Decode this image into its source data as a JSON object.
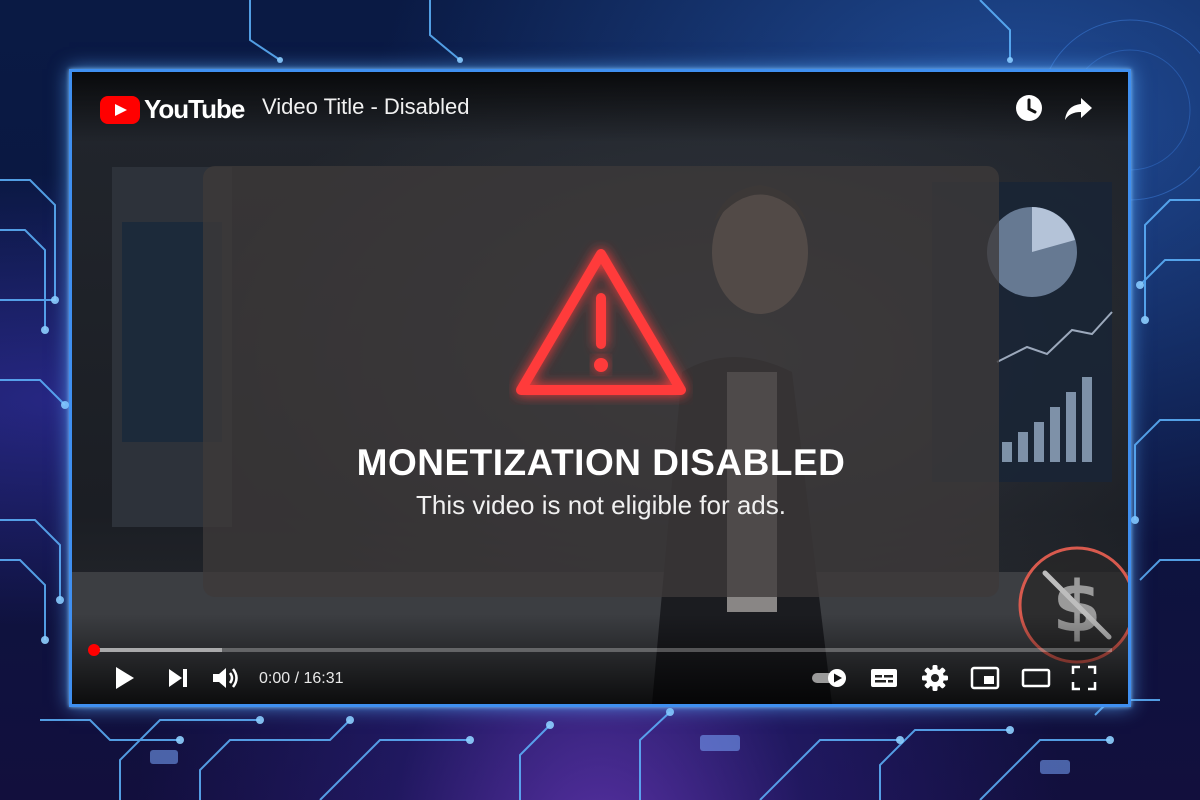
{
  "header": {
    "brand": "YouTube",
    "video_title": "Video Title - Disabled",
    "icons": [
      "watch-later-icon",
      "share-icon"
    ]
  },
  "overlay": {
    "title": "MONETIZATION DISABLED",
    "message": "This video is not eligible for ads.",
    "icon": "warning-triangle-icon",
    "accent_color": "#ff3b3b"
  },
  "badge": {
    "icon": "dollar-disabled-icon",
    "color": "#d85a4e"
  },
  "controls": {
    "time_current": "0:00",
    "time_separator": " / ",
    "time_total": "16:31",
    "progress": 0.0,
    "buttons": [
      "play-icon",
      "next-icon",
      "volume-icon",
      "autoplay-toggle-icon",
      "subtitles-icon",
      "settings-icon",
      "miniplayer-icon",
      "theater-mode-icon",
      "fullscreen-icon"
    ]
  },
  "colors": {
    "frame_glow": "#3f8ff0",
    "brand_red": "#ff0000"
  }
}
